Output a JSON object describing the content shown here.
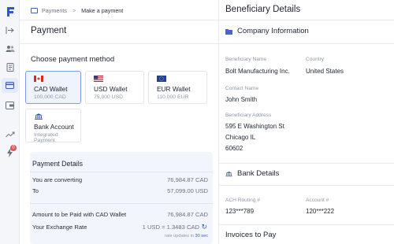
{
  "nav": {
    "logo": "F",
    "items": [
      {
        "icon": "collapse-icon"
      },
      {
        "icon": "users-icon"
      },
      {
        "icon": "ledger-icon"
      },
      {
        "icon": "payments-icon",
        "active": true
      },
      {
        "icon": "wallet-icon"
      },
      {
        "icon": "chart-icon"
      },
      {
        "icon": "bolt-icon"
      }
    ],
    "badge_count": "0"
  },
  "breadcrumb": {
    "root": "Payments",
    "sep": ">",
    "current": "Make a payment"
  },
  "page": {
    "title": "Payment",
    "choose_title": "Choose payment method"
  },
  "methods": [
    {
      "name": "CAD Wallet",
      "sub": "100,000 CAD",
      "flag": "canada-flag-icon",
      "selected": true
    },
    {
      "name": "USD Wallet",
      "sub": "75,000 USD",
      "flag": "us-flag-icon",
      "selected": false
    },
    {
      "name": "EUR Wallet",
      "sub": "110,000 EUR",
      "flag": "eu-flag-icon",
      "selected": false
    },
    {
      "name": "Bank Account",
      "sub": "Integrated Payment",
      "flag": "bank-icon",
      "selected": false
    }
  ],
  "details": {
    "title": "Payment Details",
    "converting_label": "You are converting",
    "converting_value": "76,984.87 CAD",
    "to_label": "To",
    "to_value": "57,099.00 USD",
    "amount_label": "Amount to be Paid with CAD Wallet",
    "amount_value": "76,984.87 CAD",
    "rate_label": "Your Exchange Rate",
    "rate_value": "1 USD = 1.3483 CAD",
    "note_prefix": "rate updates in",
    "note_time": "30 sec"
  },
  "beneficiary": {
    "title": "Beneficiary Details",
    "company_section": "Company Information",
    "name_label": "Beneficiary Name",
    "name_value": "Bolt Manufacturing Inc.",
    "country_label": "Country",
    "country_value": "United States",
    "contact_label": "Contact Name",
    "contact_value": "John Smith",
    "address_label": "Beneficiary Address",
    "address_line1": "595 E Washington St",
    "address_line2": "Chicago IL",
    "address_line3": "60602",
    "bank_section": "Bank Details",
    "routing_label": "ACH Routing #",
    "routing_value": "123***789",
    "account_label": "Account #",
    "account_value": "120***222",
    "invoices_section": "Invoices to Pay"
  },
  "colors": {
    "accent": "#3b5cc4",
    "selected_bg": "#eef3fe",
    "panel_bg": "#f2f5fb"
  }
}
